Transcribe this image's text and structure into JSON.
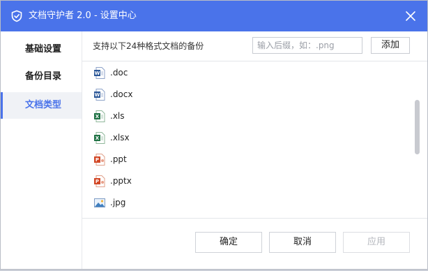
{
  "window": {
    "title": "文档守护者 2.0 - 设置中心",
    "accent_color": "#4a73ea"
  },
  "sidebar": {
    "items": [
      {
        "label": "基础设置",
        "active": false
      },
      {
        "label": "备份目录",
        "active": false
      },
      {
        "label": "文档类型",
        "active": true
      }
    ]
  },
  "toolbar": {
    "description": "支持以下24种格式文档的备份",
    "input_placeholder": "输入后缀，如：.png",
    "input_value": "",
    "add_label": "添加"
  },
  "file_types": [
    {
      "ext": ".doc",
      "icon": "word-icon"
    },
    {
      "ext": ".docx",
      "icon": "word-icon"
    },
    {
      "ext": ".xls",
      "icon": "excel-icon"
    },
    {
      "ext": ".xlsx",
      "icon": "excel-icon"
    },
    {
      "ext": ".ppt",
      "icon": "powerpoint-icon"
    },
    {
      "ext": ".pptx",
      "icon": "powerpoint-icon"
    },
    {
      "ext": ".jpg",
      "icon": "image-icon"
    }
  ],
  "footer": {
    "ok_label": "确定",
    "cancel_label": "取消",
    "apply_label": "应用",
    "apply_disabled": true
  }
}
